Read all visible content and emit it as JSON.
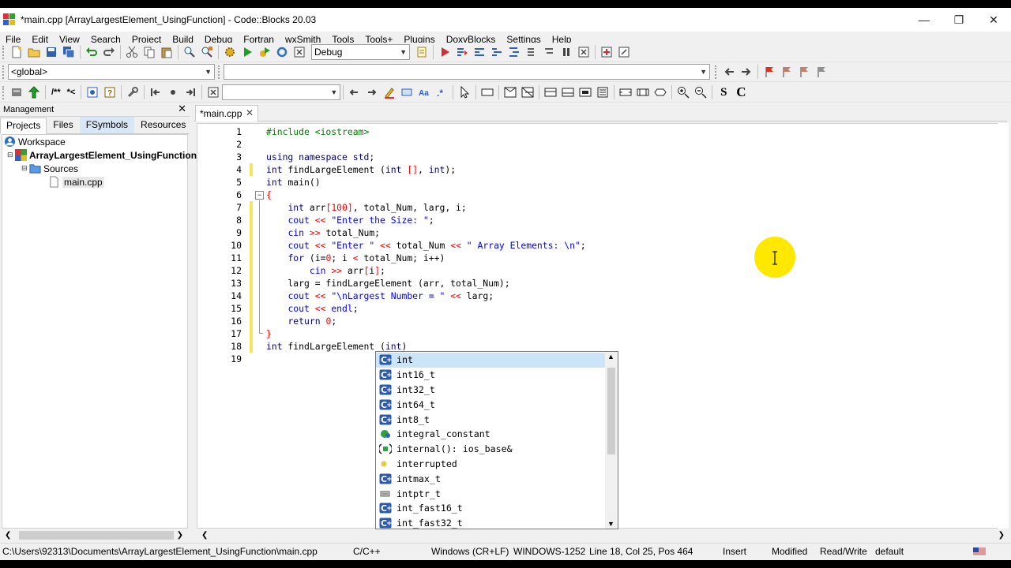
{
  "window": {
    "title": "*main.cpp [ArrayLargestElement_UsingFunction] - Code::Blocks 20.03"
  },
  "menu": [
    "File",
    "Edit",
    "View",
    "Search",
    "Project",
    "Build",
    "Debug",
    "Fortran",
    "wxSmith",
    "Tools",
    "Tools+",
    "Plugins",
    "DoxyBlocks",
    "Settings",
    "Help"
  ],
  "toolbar": {
    "build_target": "Debug",
    "scope": "<global>",
    "function_combo": "",
    "search_combo": "",
    "doxy_comment_block": "/**",
    "doxy_comment_line": "*<",
    "bold_s": "S",
    "bold_c": "C"
  },
  "management": {
    "title": "Management",
    "tabs": [
      "Projects",
      "Files",
      "FSymbols",
      "Resources"
    ],
    "tree": {
      "workspace": "Workspace",
      "project": "ArrayLargestElement_UsingFunction",
      "folder": "Sources",
      "file": "main.cpp"
    }
  },
  "editor": {
    "tab_label": "*main.cpp",
    "line_numbers": [
      "1",
      "2",
      "3",
      "4",
      "5",
      "6",
      "7",
      "8",
      "9",
      "10",
      "11",
      "12",
      "13",
      "14",
      "15",
      "16",
      "17",
      "18",
      "19"
    ],
    "lines": [
      "#include <iostream>",
      "",
      "using namespace std;",
      "int findLargeElement (int [], int);",
      "int main()",
      "{",
      "    int arr[100], total_Num, larg, i;",
      "    cout << \"Enter the Size: \";",
      "    cin >> total_Num;",
      "    cout << \"Enter \" << total_Num << \" Array Elements: \\n\";",
      "    for (i=0; i < total_Num; i++)",
      "        cin >> arr[i];",
      "    larg = findLargeElement (arr, total_Num);",
      "    cout << \"\\nLargest Number = \" << larg;",
      "    cout << endl;",
      "    return 0;",
      "}",
      "int findLargeElement (int)",
      ""
    ]
  },
  "autocomplete": {
    "items": [
      {
        "label": "int",
        "icon": "class-icon"
      },
      {
        "label": "int16_t",
        "icon": "class-icon"
      },
      {
        "label": "int32_t",
        "icon": "class-icon"
      },
      {
        "label": "int64_t",
        "icon": "class-icon"
      },
      {
        "label": "int8_t",
        "icon": "class-icon"
      },
      {
        "label": "integral_constant",
        "icon": "namespace-icon"
      },
      {
        "label": "internal(): ios_base&",
        "icon": "function-icon"
      },
      {
        "label": "interrupted",
        "icon": "enumerator-icon"
      },
      {
        "label": "intmax_t",
        "icon": "class-icon"
      },
      {
        "label": "intptr_t",
        "icon": "typedef-icon"
      },
      {
        "label": "int_fast16_t",
        "icon": "class-icon"
      },
      {
        "label": "int_fast32_t",
        "icon": "class-icon"
      }
    ],
    "selected_index": 0
  },
  "statusbar": {
    "path": "C:\\Users\\92313\\Documents\\ArrayLargestElement_UsingFunction\\main.cpp",
    "language": "C/C++",
    "eol": "Windows (CR+LF)",
    "encoding": "WINDOWS-1252",
    "position": "Line 18, Col 25, Pos 464",
    "mode": "Insert",
    "modified": "Modified",
    "access": "Read/Write",
    "profile": "default"
  },
  "colors": {
    "keyword": "#00008b",
    "preprocessor": "#008000",
    "string": "#0000ff",
    "number": "#ff0000",
    "change_bar": "#f5e55a",
    "cursor_highlight": "#ffe800",
    "autocomplete_selection": "#cce4f7"
  }
}
